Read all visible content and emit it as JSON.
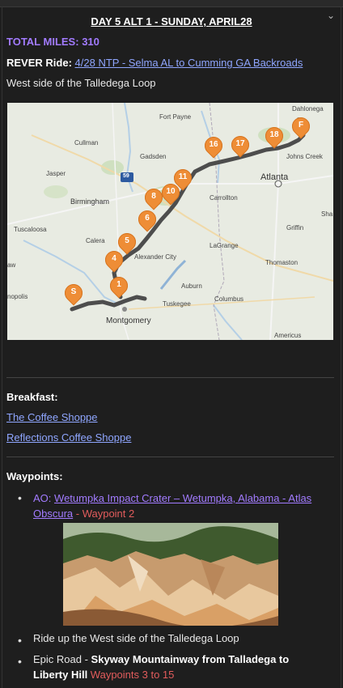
{
  "header": {
    "title": "DAY 5 ALT 1 - SUNDAY, APRIL28"
  },
  "total_miles": {
    "label": "TOTAL MILES:",
    "value": "310"
  },
  "rever": {
    "label": "REVER Ride:",
    "link": "4/28 NTP - Selma AL to Cumming GA Backroads"
  },
  "intro_line": "West side of the Talledega Loop",
  "map": {
    "places": [
      "Dahlonega",
      "Fort Payne",
      "Cullman",
      "Gadsden",
      "Johns Creek",
      "Atlanta",
      "Jasper",
      "Birmingham",
      "Carrollton",
      "Sha",
      "Tuscaloosa",
      "Griffin",
      "Calera",
      "LaGrange",
      "Alexander City",
      "Thomaston",
      "Auburn",
      "Montgomery",
      "Columbus",
      "Tuskegee",
      "Americus",
      "nopolis",
      "aw"
    ],
    "markers": [
      "F",
      "18",
      "17",
      "16",
      "11",
      "10",
      "8",
      "6",
      "5",
      "4",
      "1",
      "S"
    ],
    "highway": "59"
  },
  "breakfast": {
    "label": "Breakfast:",
    "items": [
      "The Coffee Shoppe",
      "Reflections Coffee Shoppe"
    ]
  },
  "waypoints": {
    "label": "Waypoints:",
    "items": [
      {
        "prefix": "AO:",
        "link": "Wetumpka Impact Crater – Wetumpka, Alabama - Atlas Obscura",
        "note": " - Waypoint 2"
      },
      {
        "text": "Ride up the West side of the Talledega Loop"
      },
      {
        "prefix": "Epic Road - ",
        "bold": "Skyway Mountainway from Talladega to Liberty Hill",
        "note": " Waypoints 3 to 15"
      }
    ]
  },
  "colors": {
    "accent": "#a27bff",
    "link": "#8fa6ff",
    "note": "#e25c5c",
    "marker": "#ee8d36",
    "route": "#555555"
  }
}
